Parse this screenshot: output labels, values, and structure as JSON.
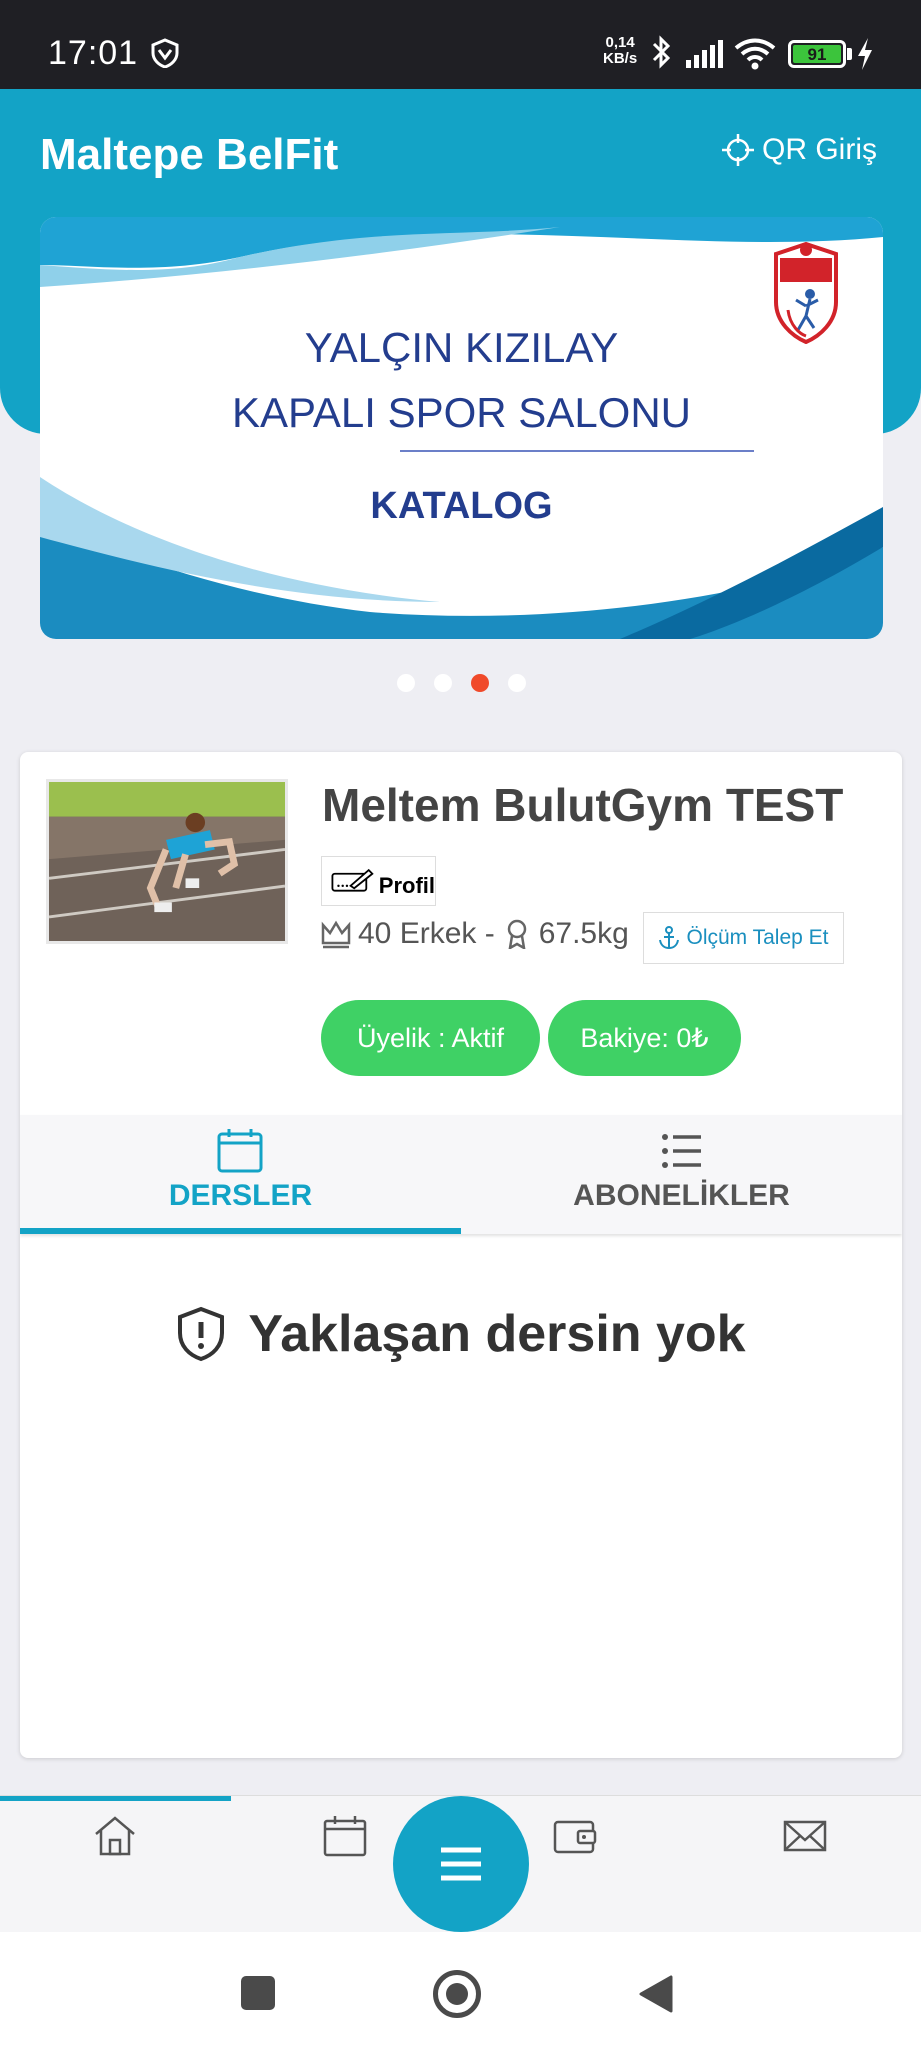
{
  "status_bar": {
    "time": "17:01",
    "net_speed_value": "0,14",
    "net_speed_unit": "KB/s",
    "battery": "91"
  },
  "header": {
    "app_title": "Maltepe BelFit",
    "qr_label": "QR Giriş"
  },
  "banner": {
    "line1": "YALÇIN KIZILAY",
    "line2": "KAPALI SPOR SALONU",
    "line3": "KATALOG",
    "slide_count": 4,
    "active_slide": 3
  },
  "profile": {
    "name": "Meltem BulutGym TEST",
    "profile_button": "Profil",
    "age_gender": "40 Erkek -",
    "weight": "67.5kg",
    "measure_button": "Ölçüm Talep Et",
    "membership": "Üyelik : Aktif",
    "balance": "Bakiye: 0₺"
  },
  "tabs": [
    {
      "label": "DERSLER",
      "icon": "calendar-icon",
      "active": true
    },
    {
      "label": "ABONELİKLER",
      "icon": "list-icon",
      "active": false
    }
  ],
  "empty_state": {
    "icon": "shield-alert-icon",
    "text": "Yaklaşan dersin yok"
  },
  "bottom_nav": {
    "items": [
      "home-icon",
      "calendar-icon",
      "menu-icon",
      "wallet-icon",
      "mail-icon"
    ],
    "active_index": 0
  },
  "colors": {
    "primary": "#13a3c6",
    "success": "#3fd165",
    "dot_active": "#f04a2a",
    "banner_text": "#233d8e"
  }
}
